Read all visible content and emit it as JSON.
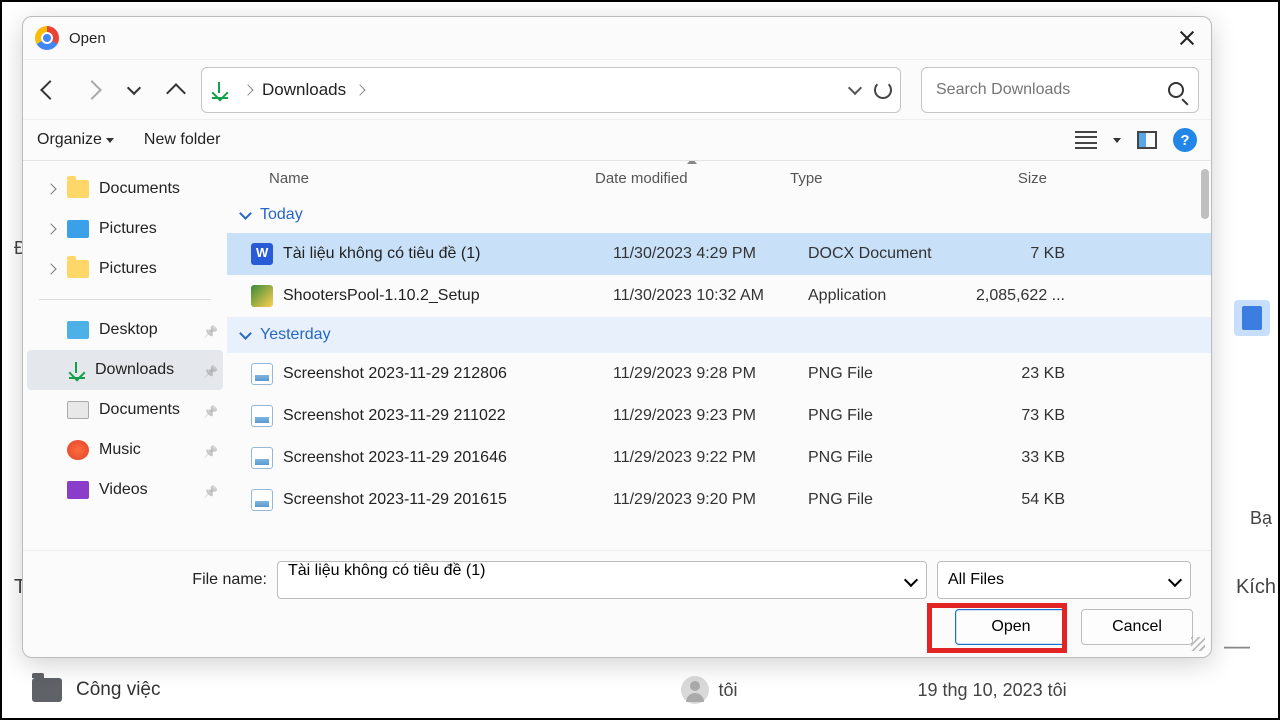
{
  "titlebar": {
    "title": "Open"
  },
  "path": {
    "segment": "Downloads"
  },
  "search": {
    "placeholder": "Search Downloads"
  },
  "toolbar": {
    "organize": "Organize",
    "newfolder": "New folder"
  },
  "footer": {
    "filename_label": "File name:",
    "filename_value": "Tài liệu không có tiêu đề (1)",
    "filetype": "All Files",
    "open": "Open",
    "cancel": "Cancel"
  },
  "columns": {
    "name": "Name",
    "date": "Date modified",
    "type": "Type",
    "size": "Size"
  },
  "sidebar_top": [
    {
      "label": "Documents",
      "icon": "folder"
    },
    {
      "label": "Pictures",
      "icon": "pic"
    },
    {
      "label": "Pictures",
      "icon": "folder"
    }
  ],
  "sidebar_pinned": [
    {
      "label": "Desktop",
      "icon": "desk"
    },
    {
      "label": "Downloads",
      "icon": "dl",
      "active": true
    },
    {
      "label": "Documents",
      "icon": "doc"
    },
    {
      "label": "Music",
      "icon": "music"
    },
    {
      "label": "Videos",
      "icon": "vid"
    }
  ],
  "groups": [
    {
      "label": "Today",
      "hover": false,
      "items": [
        {
          "name": "Tài liệu không có tiêu đề (1)",
          "date": "11/30/2023 4:29 PM",
          "type": "DOCX Document",
          "size": "7 KB",
          "icon": "docx",
          "selected": true
        },
        {
          "name": "ShootersPool-1.10.2_Setup",
          "date": "11/30/2023 10:32 AM",
          "type": "Application",
          "size": "2,085,622 ...",
          "icon": "exe"
        }
      ]
    },
    {
      "label": "Yesterday",
      "hover": true,
      "items": [
        {
          "name": "Screenshot 2023-11-29 212806",
          "date": "11/29/2023 9:28 PM",
          "type": "PNG File",
          "size": "23 KB",
          "icon": "png"
        },
        {
          "name": "Screenshot 2023-11-29 211022",
          "date": "11/29/2023 9:23 PM",
          "type": "PNG File",
          "size": "73 KB",
          "icon": "png"
        },
        {
          "name": "Screenshot 2023-11-29 201646",
          "date": "11/29/2023 9:22 PM",
          "type": "PNG File",
          "size": "33 KB",
          "icon": "png"
        },
        {
          "name": "Screenshot 2023-11-29 201615",
          "date": "11/29/2023 9:20 PM",
          "type": "PNG File",
          "size": "54 KB",
          "icon": "png"
        }
      ]
    }
  ],
  "background": {
    "folder_label": "Công việc",
    "user_label": "tôi",
    "date_line": "19 thg 10, 2023 tôi",
    "right_text_1": "Bạ",
    "right_text_2": "Kích"
  }
}
